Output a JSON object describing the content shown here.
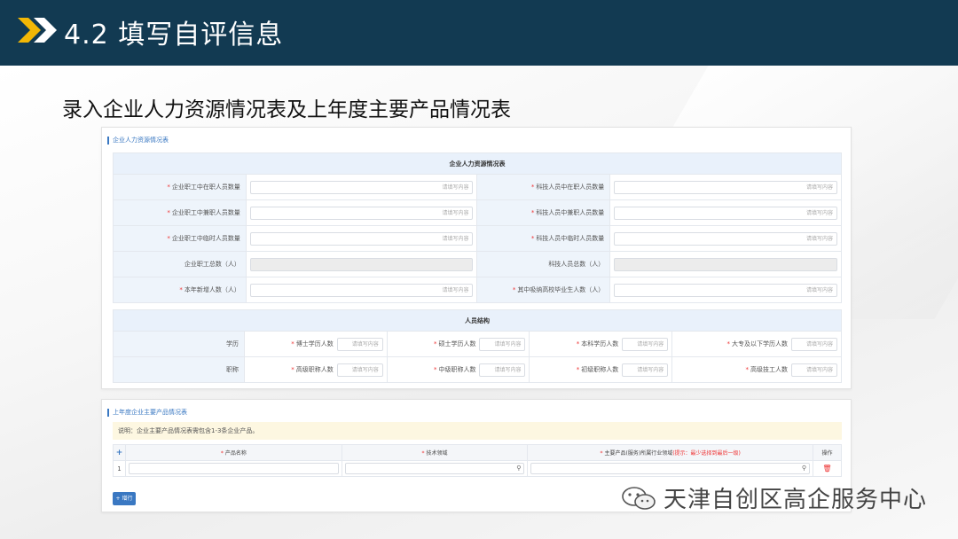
{
  "header": {
    "title": "4.2 填写自评信息"
  },
  "subtitle": "录入企业人力资源情况表及上年度主要产品情况表",
  "hr": {
    "section_title": "企业人力资源情况表",
    "table_title": "企业人力资源情况表",
    "placeholder": "请填写内容",
    "rows": [
      {
        "left": "企业职工中在职人员数量",
        "left_req": true,
        "right": "科技人员中在职人员数量",
        "right_req": true,
        "disabled": false
      },
      {
        "left": "企业职工中兼职人员数量",
        "left_req": true,
        "right": "科技人员中兼职人员数量",
        "right_req": true,
        "disabled": false
      },
      {
        "left": "企业职工中临时人员数量",
        "left_req": true,
        "right": "科技人员中临时人员数量",
        "right_req": true,
        "disabled": false
      },
      {
        "left": "企业职工总数（人）",
        "left_req": false,
        "right": "科技人员总数（人）",
        "right_req": false,
        "disabled": true
      },
      {
        "left": "本年新增人数（人）",
        "left_req": true,
        "right": "其中吸纳高校毕业生人数（人）",
        "right_req": true,
        "disabled": false
      }
    ]
  },
  "structure": {
    "table_title": "人员结构",
    "placeholder": "请填写内容",
    "rows": [
      {
        "label": "学历",
        "items": [
          "博士学历人数",
          "硕士学历人数",
          "本科学历人数",
          "大专及以下学历人数"
        ]
      },
      {
        "label": "职称",
        "items": [
          "高级职称人数",
          "中级职称人数",
          "初级职称人数",
          "高级技工人数"
        ]
      }
    ]
  },
  "products": {
    "section_title": "上年度企业主要产品情况表",
    "note": "说明：企业主要产品情况表需包含1-3条企业产品。",
    "add_icon": "+",
    "columns": {
      "name": "产品名称",
      "tech": "技术领域",
      "industry": "主要产品(服务)所属行业领域",
      "industry_hint": "(提示：最少选择到最后一级)",
      "op": "操作"
    },
    "row_index": "1",
    "add_button": "+ 增行"
  },
  "watermark": {
    "text": "天津自创区高企服务中心"
  },
  "colors": {
    "header_bg": "#123a52",
    "accent": "#3a78c2",
    "arrow": "#f2b705"
  }
}
